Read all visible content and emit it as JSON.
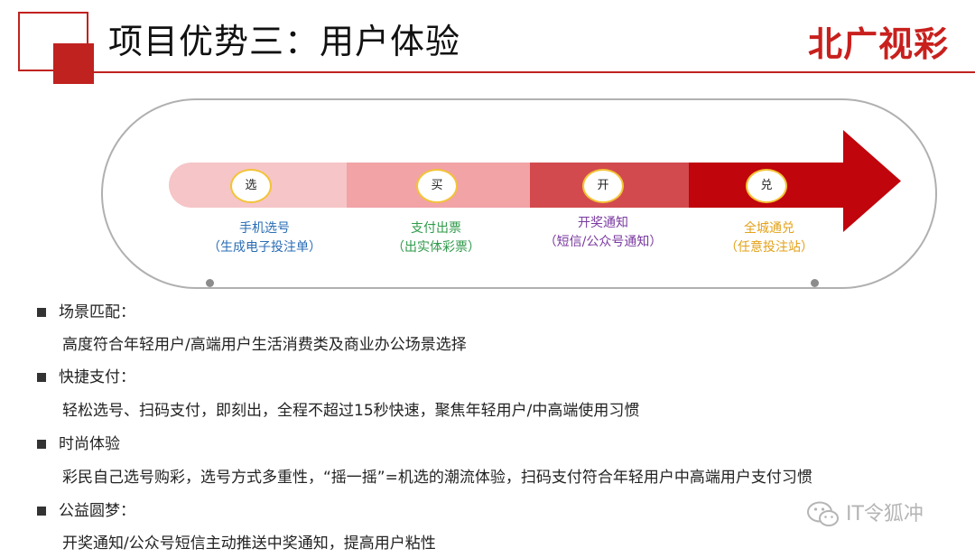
{
  "header": {
    "title": "项目优势三：用户体验",
    "logo_text": "北广视彩",
    "accent_color": "#c0221f"
  },
  "flow": {
    "steps": [
      {
        "badge": "选",
        "label": "手机选号",
        "sublabel": "（生成电子投注单）",
        "text_color": "#2a6db5",
        "segment_color": "#f6c5c7"
      },
      {
        "badge": "买",
        "label": "支付出票",
        "sublabel": "（出实体彩票）",
        "text_color": "#2f9a4a",
        "segment_color": "#f1a3a6"
      },
      {
        "badge": "开",
        "label": "开奖通知",
        "sublabel": "（短信/公众号通知）",
        "text_color": "#7a3aa0",
        "segment_color": "#d24a4e"
      },
      {
        "badge": "兑",
        "label": "全城通兑",
        "sublabel": "（任意投注站）",
        "text_color": "#e3a21a",
        "segment_color": "#c0050c"
      }
    ]
  },
  "features": [
    {
      "title": "场景匹配：",
      "body": "高度符合年轻用户/高端用户生活消费类及商业办公场景选择"
    },
    {
      "title": "快捷支付：",
      "body": "轻松选号、扫码支付，即刻出，全程不超过15秒快速，聚焦年轻用户/中高端使用习惯"
    },
    {
      "title": "时尚体验",
      "body": "彩民自己选号购彩，选号方式多重性，“摇一摇”=机选的潮流体验，扫码支付符合年轻用户中高端用户支付习惯"
    },
    {
      "title": "公益圆梦：",
      "body": "开奖通知/公众号短信主动推送中奖通知，提高用户粘性"
    }
  ],
  "watermark": {
    "text": "IT令狐冲",
    "icon": "wechat-icon"
  }
}
